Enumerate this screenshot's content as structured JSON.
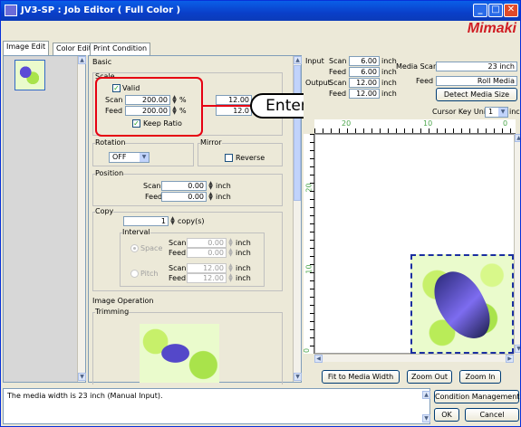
{
  "window": {
    "title": "JV3-SP : Job Editor ( Full Color )",
    "logo": "Mimaki"
  },
  "tabs": [
    {
      "label": "Image Edit"
    },
    {
      "label": "Color Edit"
    },
    {
      "label": "Print Condition"
    }
  ],
  "basic": {
    "title": "Basic",
    "scale": {
      "title": "Scale",
      "valid_label": "Valid",
      "scan_label": "Scan",
      "scan_value": "200.00",
      "feed_label": "Feed",
      "feed_value": "200.00",
      "percent": "%",
      "scan_inch_value": "12.00",
      "feed_inch_value": "12.0",
      "keep_ratio_label": "Keep Ratio"
    },
    "rotation": {
      "title": "Rotation",
      "value": "OFF"
    },
    "mirror": {
      "title": "Mirror",
      "reverse_label": "Reverse"
    },
    "position": {
      "title": "Position",
      "scan_label": "Scan",
      "scan_value": "0.00",
      "feed_label": "Feed",
      "feed_value": "0.00",
      "unit": "inch"
    },
    "copy": {
      "title": "Copy",
      "count_value": "1",
      "count_unit": "copy(s)",
      "interval_title": "Interval",
      "space_label": "Space",
      "pitch_label": "Pitch",
      "space_scan_label": "Scan",
      "space_scan_value": "0.00",
      "space_feed_label": "Feed",
      "space_feed_value": "0.00",
      "pitch_scan_label": "Scan",
      "pitch_scan_value": "12.00",
      "pitch_feed_label": "Feed",
      "pitch_feed_value": "12.00",
      "unit": "inch"
    }
  },
  "image_operation": {
    "title": "Image Operation",
    "trimming_title": "Trimming"
  },
  "callout": {
    "label": "Enter"
  },
  "info": {
    "input_label": "Input",
    "input_scan_label": "Scan",
    "input_scan_value": "6.00",
    "input_feed_label": "Feed",
    "input_feed_value": "6.00",
    "output_label": "Output",
    "output_scan_label": "Scan",
    "output_scan_value": "12.00",
    "output_feed_label": "Feed",
    "output_feed_value": "12.00",
    "unit": "inch",
    "media_scan_label": "Media Scan",
    "media_scan_value": "23 inch",
    "media_feed_label": "Feed",
    "media_feed_value": "Roll Media",
    "detect_button": "Detect Media Size",
    "cursor_key_label": "Cursor Key Unit",
    "cursor_key_value": "1",
    "cursor_key_unit": "inch"
  },
  "ruler": {
    "top_ticks": [
      "20",
      "10",
      "0"
    ],
    "left_ticks": [
      "20",
      "10",
      "0"
    ]
  },
  "preview_buttons": {
    "fit": "Fit to Media Width",
    "zoom_out": "Zoom Out",
    "zoom_in": "Zoom In"
  },
  "status": {
    "message": "The media width is 23 inch (Manual Input)."
  },
  "footer": {
    "condition_button": "Condition Management",
    "ok_button": "OK",
    "cancel_button": "Cancel"
  }
}
